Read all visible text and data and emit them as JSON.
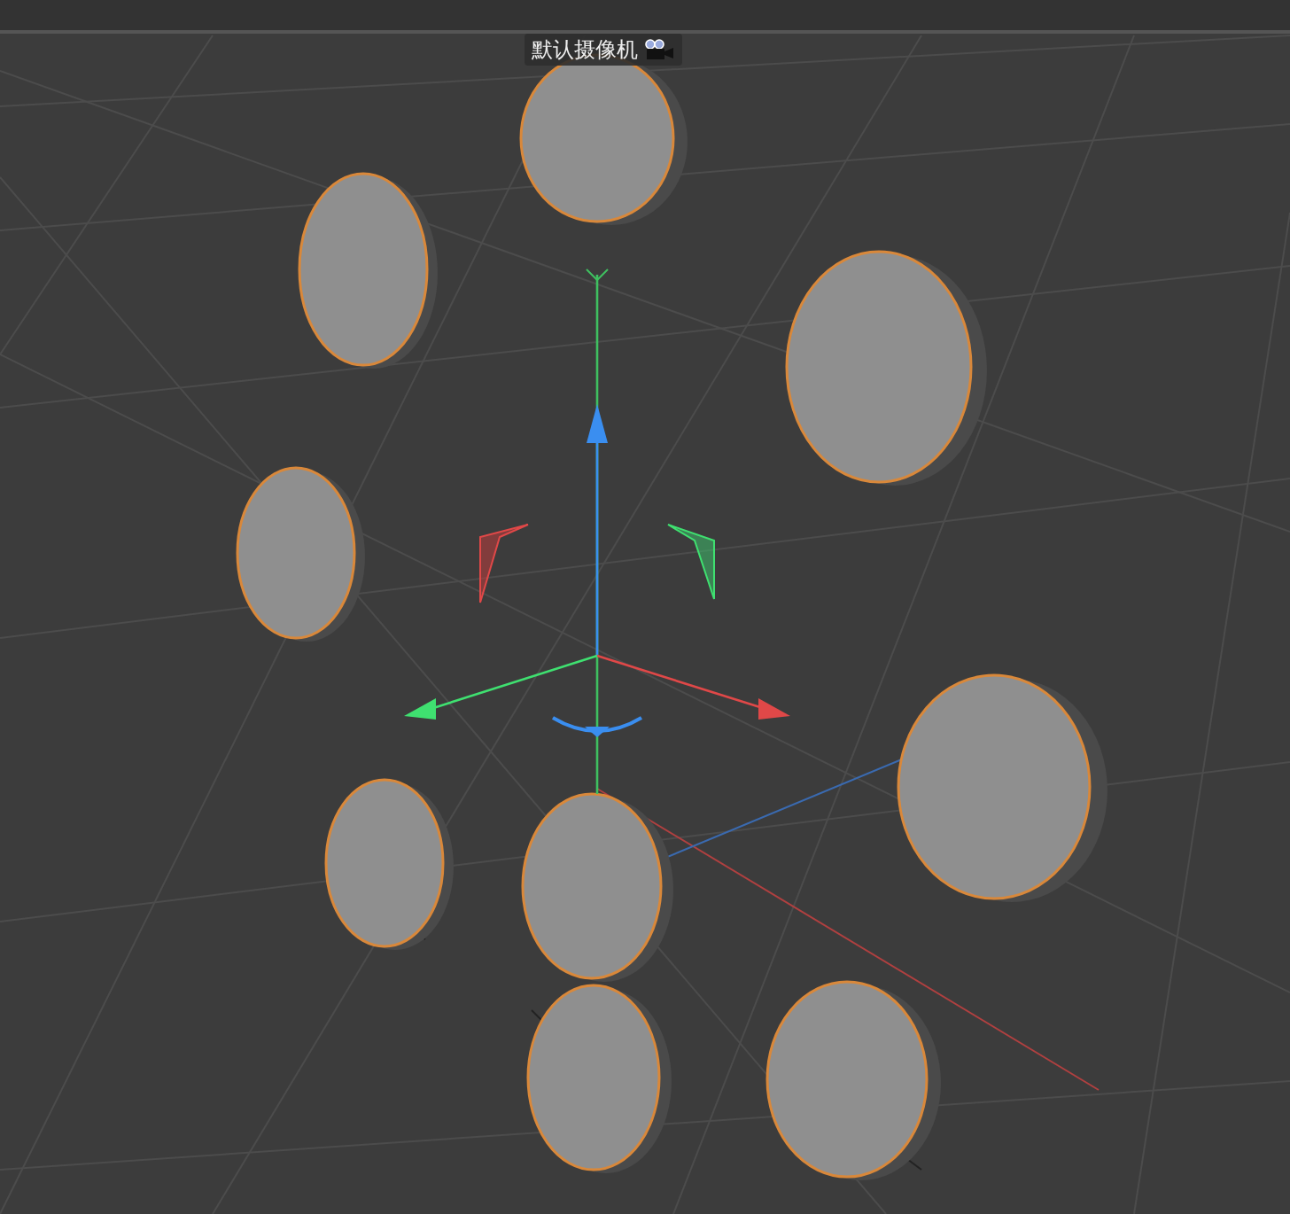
{
  "viewport": {
    "camera_label": "默认摄像机"
  }
}
